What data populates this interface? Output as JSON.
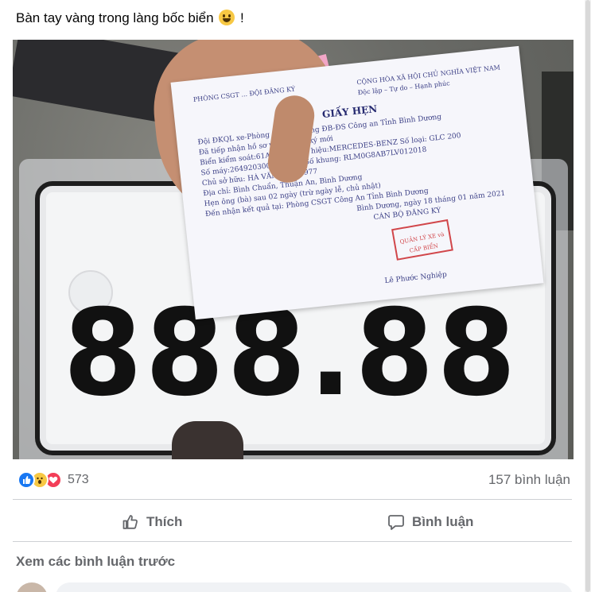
{
  "post": {
    "caption": "Bàn tay vàng trong làng bốc biển",
    "caption_emoji": "grinning-face-emoji",
    "caption_suffix": " !"
  },
  "photo": {
    "plate_number": "888.88",
    "paper": {
      "header_left": "PHÒNG CSGT ... ĐỘI ĐĂNG KÝ",
      "header_right": "CỘNG HÒA XÃ HỘI CHỦ NGHĨA VIỆT NAM",
      "header_right_sub": "Độc lập – Tự do – Hạnh phúc",
      "title": "GIẤY HẸN",
      "lines": [
        "Đội ĐKQL xe-Phòng ... giao thông ĐB-ĐS Công an Tỉnh Bình Dương",
        "Đã tiếp nhận hồ sơ về ... đăng ký mới",
        "Biển kiểm soát:61A-88... nhãn hiệu:MERCEDES-BENZ   Số loại: GLC 200",
        "Số máy:26492030028791 ...   Số khung: RLM0G8AB7LV012018",
        "Chủ sở hữu: HÀ VĂN DÂN   1977",
        "Địa chỉ: Bình Chuẩn, Thuận An, Bình Dương",
        "Hẹn ông (bà) sau 02 ngày (trừ ngày lễ, chủ nhật)",
        "Đến nhận kết quả tại: Phòng CSGT Công An Tỉnh Bình Dương",
        "Bình Dương, ngày 18 tháng 01 năm 2021",
        "CÁN BỘ ĐĂNG KÝ"
      ],
      "stamp": "QUẢN LÝ XE và CẤP BIỂN",
      "signer": "Lê Phước Nghiệp"
    }
  },
  "reactions": {
    "icons": [
      "like-icon",
      "wow-icon",
      "love-icon"
    ],
    "count": "573",
    "comments": "157 bình luận"
  },
  "actions": {
    "like_label": "Thích",
    "comment_label": "Bình luận"
  },
  "comments": {
    "view_previous": "Xem các bình luận trước"
  },
  "colors": {
    "like_blue": "#1877f2",
    "love_red": "#f33e58",
    "wow_yellow": "#f7c844",
    "muted_text": "#65676b"
  }
}
